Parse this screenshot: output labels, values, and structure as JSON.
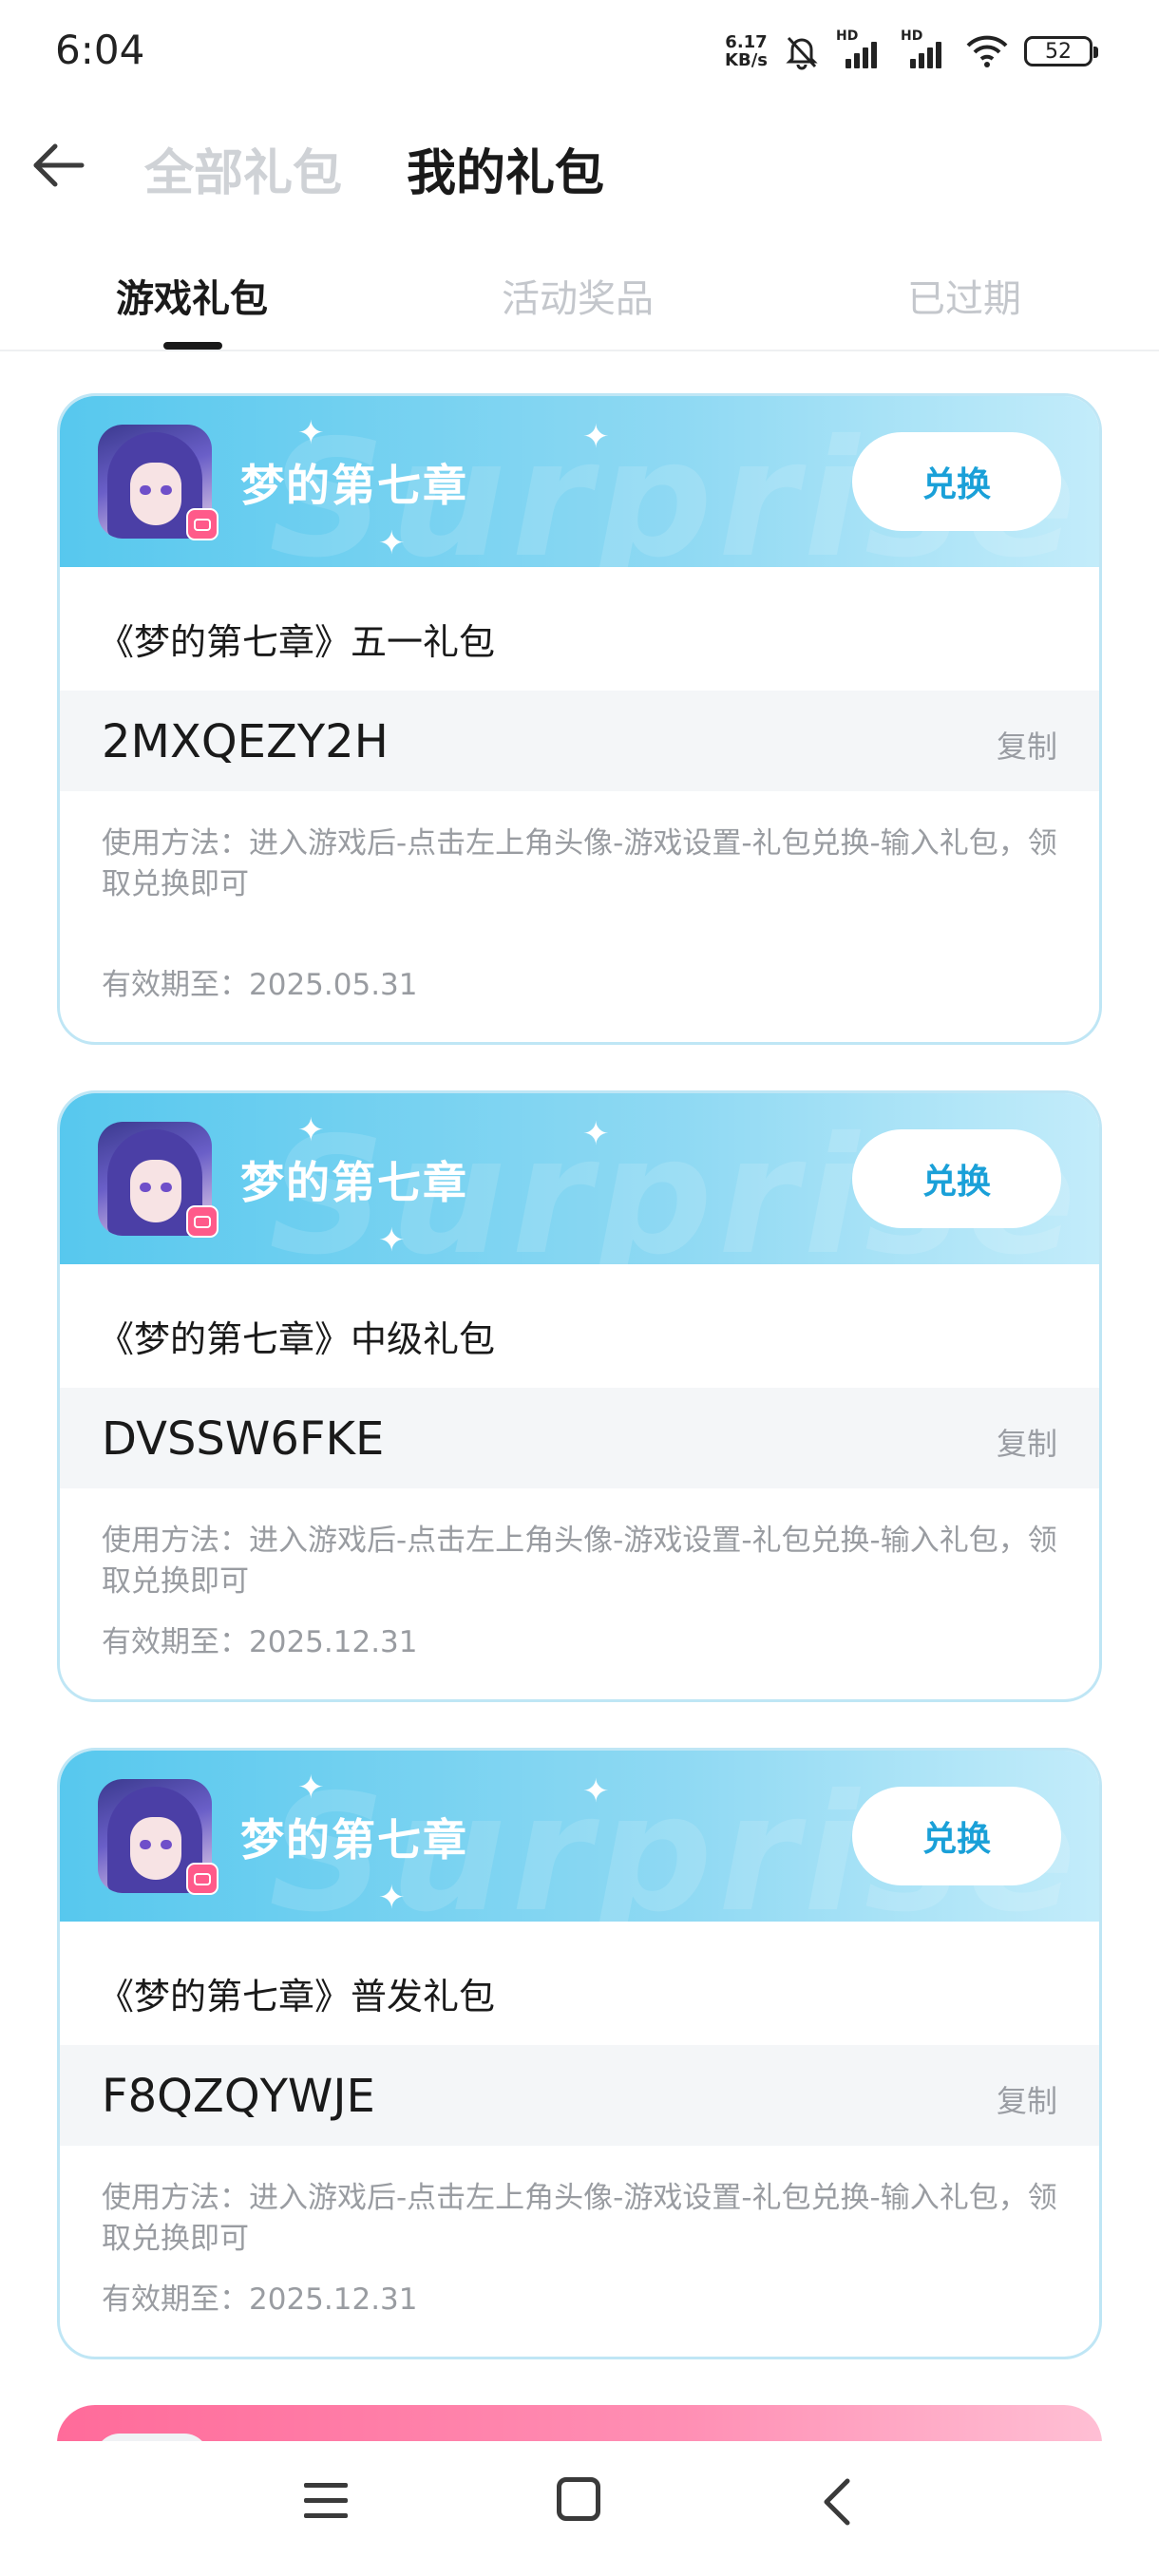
{
  "status_bar": {
    "time": "6:04",
    "net_speed_value": "6.17",
    "net_speed_unit": "KB/s",
    "battery": "52",
    "icons": [
      "mute-bell-icon",
      "hd-signal-icon",
      "hd-signal-icon",
      "wifi-icon",
      "battery-icon"
    ]
  },
  "header": {
    "tabs": [
      "全部礼包",
      "我的礼包"
    ],
    "active_tab": "我的礼包"
  },
  "sub_tabs": {
    "items": [
      "游戏礼包",
      "活动奖品",
      "已过期"
    ],
    "active": "游戏礼包"
  },
  "cards": [
    {
      "game_name": "梦的第七章",
      "redeem_label": "兑换",
      "gift_title": "《梦的第七章》五一礼包",
      "code": "2MXQEZY2H",
      "copy_label": "复制",
      "usage": "使用方法：进入游戏后-点击左上角头像-游戏设置-礼包兑换-输入礼包，领取兑换即可",
      "expiry": "有效期至：2025.05.31"
    },
    {
      "game_name": "梦的第七章",
      "redeem_label": "兑换",
      "gift_title": "《梦的第七章》中级礼包",
      "code": "DVSSW6FKE",
      "copy_label": "复制",
      "usage": "使用方法：进入游戏后-点击左上角头像-游戏设置-礼包兑换-输入礼包，领取兑换即可",
      "expiry": "有效期至：2025.12.31"
    },
    {
      "game_name": "梦的第七章",
      "redeem_label": "兑换",
      "gift_title": "《梦的第七章》普发礼包",
      "code": "F8QZQYWJE",
      "copy_label": "复制",
      "usage": "使用方法：进入游戏后-点击左上角头像-游戏设置-礼包兑换-输入礼包，领取兑换即可",
      "expiry": "有效期至：2025.12.31"
    }
  ],
  "card_watermark": "Surprise",
  "colors": {
    "card_header_start": "#57c8ee",
    "card_header_end": "#c3ecfa",
    "card_border": "#bfe6f5",
    "redeem_text": "#1aa0d8",
    "next_card_header": "#ff6b9a"
  },
  "nav_bar": {
    "icons": [
      "menu-icon",
      "home-icon",
      "back-icon"
    ]
  }
}
